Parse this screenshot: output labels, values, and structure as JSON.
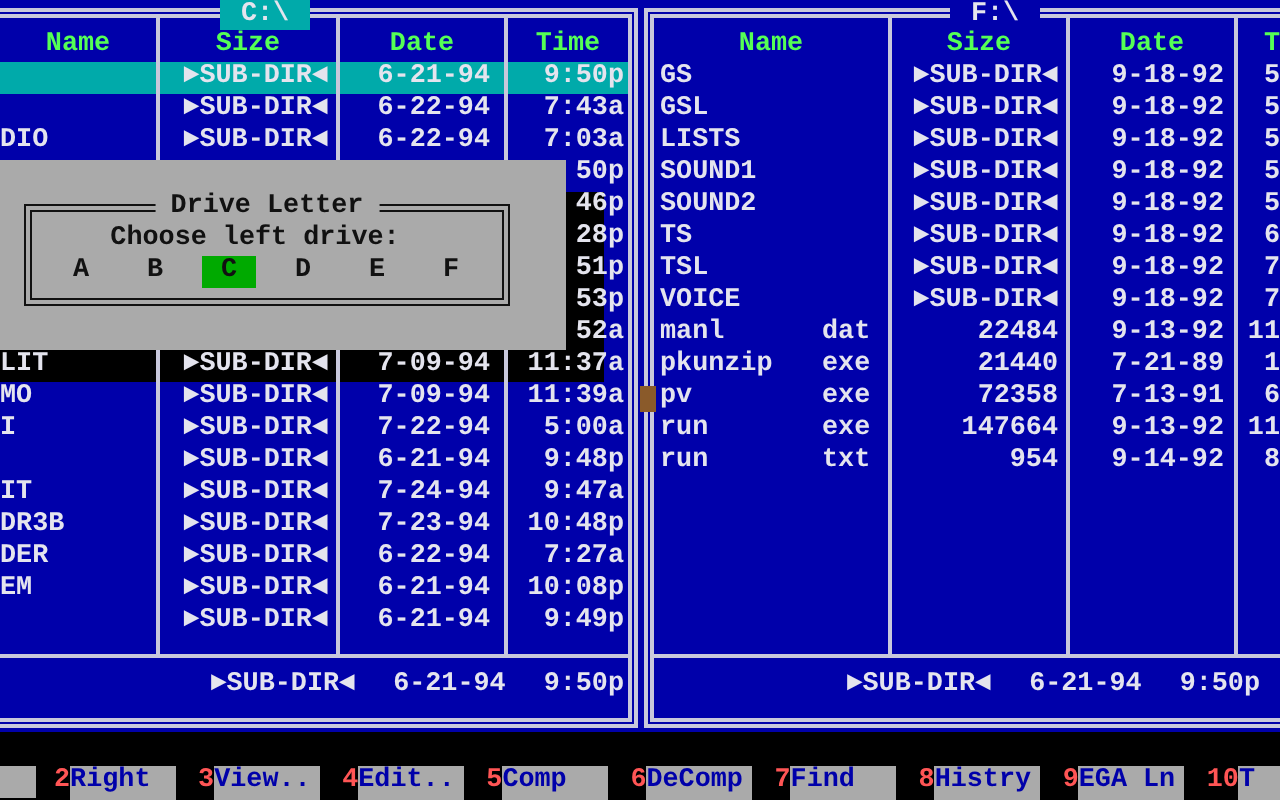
{
  "panels": [
    {
      "title": "C:\\",
      "active": true,
      "columns": [
        "Name",
        "Size",
        "Date",
        "Time"
      ],
      "rows": [
        {
          "size": "►SUB-DIR◄",
          "date": "6-21-94",
          "time": "9:50p",
          "selected": true
        },
        {
          "size": "►SUB-DIR◄",
          "date": "6-22-94",
          "time": "7:43a",
          "selected": false
        },
        {
          "name": "DIO",
          "size": "►SUB-DIR◄",
          "date": "6-22-94",
          "time": "7:03a",
          "selected": false
        },
        {
          "time": "50p",
          "selected": false
        },
        {
          "time": "46p",
          "selected": false
        },
        {
          "time": "28p",
          "selected": false
        },
        {
          "time": "51p",
          "selected": false
        },
        {
          "time": "53p",
          "selected": false
        },
        {
          "time": "52a",
          "selected": false
        },
        {
          "name": "LIT",
          "size": "►SUB-DIR◄",
          "date": "7-09-94",
          "time": "11:37a",
          "selected": false
        },
        {
          "name": "MO",
          "size": "►SUB-DIR◄",
          "date": "7-09-94",
          "time": "11:39a",
          "selected": false
        },
        {
          "name": "I",
          "size": "►SUB-DIR◄",
          "date": "7-22-94",
          "time": "5:00a",
          "selected": false
        },
        {
          "size": "►SUB-DIR◄",
          "date": "6-21-94",
          "time": "9:48p",
          "selected": false
        },
        {
          "name": "IT",
          "size": "►SUB-DIR◄",
          "date": "7-24-94",
          "time": "9:47a",
          "selected": false
        },
        {
          "name": "DR3B",
          "size": "►SUB-DIR◄",
          "date": "7-23-94",
          "time": "10:48p",
          "selected": false
        },
        {
          "name": "DER",
          "size": "►SUB-DIR◄",
          "date": "6-22-94",
          "time": "7:27a",
          "selected": false
        },
        {
          "name": "EM",
          "size": "►SUB-DIR◄",
          "date": "6-21-94",
          "time": "10:08p",
          "selected": false
        },
        {
          "size": "►SUB-DIR◄",
          "date": "6-21-94",
          "time": "9:49p",
          "selected": false
        }
      ],
      "status": {
        "size": "►SUB-DIR◄",
        "date": "6-21-94",
        "time": "9:50p"
      }
    },
    {
      "title": "F:\\",
      "active": false,
      "columns": [
        "Name",
        "Size",
        "Date",
        "T"
      ],
      "rows": [
        {
          "name": "GS",
          "size": "►SUB-DIR◄",
          "date": "9-18-92",
          "time": "5",
          "selected": false
        },
        {
          "name": "GSL",
          "size": "►SUB-DIR◄",
          "date": "9-18-92",
          "time": "5",
          "selected": false
        },
        {
          "name": "LISTS",
          "size": "►SUB-DIR◄",
          "date": "9-18-92",
          "time": "5",
          "selected": false
        },
        {
          "name": "SOUND1",
          "size": "►SUB-DIR◄",
          "date": "9-18-92",
          "time": "5",
          "selected": false
        },
        {
          "name": "SOUND2",
          "size": "►SUB-DIR◄",
          "date": "9-18-92",
          "time": "5",
          "selected": false
        },
        {
          "name": "TS",
          "size": "►SUB-DIR◄",
          "date": "9-18-92",
          "time": "6",
          "selected": false
        },
        {
          "name": "TSL",
          "size": "►SUB-DIR◄",
          "date": "9-18-92",
          "time": "7",
          "selected": false
        },
        {
          "name": "VOICE",
          "size": "►SUB-DIR◄",
          "date": "9-18-92",
          "time": "7",
          "selected": false
        },
        {
          "name": "manl",
          "ext": "dat",
          "size": "22484",
          "date": "9-13-92",
          "time": "11",
          "selected": false
        },
        {
          "name": "pkunzip",
          "ext": "exe",
          "size": "21440",
          "date": "7-21-89",
          "time": "1",
          "selected": false
        },
        {
          "name": "pv",
          "ext": "exe",
          "size": "72358",
          "date": "7-13-91",
          "time": "6",
          "selected": false
        },
        {
          "name": "run",
          "ext": "exe",
          "size": "147664",
          "date": "9-13-92",
          "time": "11",
          "selected": false
        },
        {
          "name": "run",
          "ext": "txt",
          "size": "954",
          "date": "9-14-92",
          "time": "8",
          "selected": false
        }
      ],
      "status": {
        "size": "►SUB-DIR◄",
        "date": "6-21-94",
        "time": "9:50p"
      }
    }
  ],
  "dialog": {
    "title": "Drive Letter",
    "prompt": "Choose **left** drive:",
    "drives": [
      {
        "letter": "A",
        "selected": false
      },
      {
        "letter": "B",
        "selected": false
      },
      {
        "letter": "C",
        "selected": true
      },
      {
        "letter": "D",
        "selected": false
      },
      {
        "letter": "E",
        "selected": false
      },
      {
        "letter": "F",
        "selected": false
      }
    ]
  },
  "function_keys": [
    {
      "number": "2",
      "label": "Right"
    },
    {
      "number": "3",
      "label": "View.."
    },
    {
      "number": "4",
      "label": "Edit.."
    },
    {
      "number": "5",
      "label": "Comp"
    },
    {
      "number": "6",
      "label": "DeComp"
    },
    {
      "number": "7",
      "label": "Find"
    },
    {
      "number": "8",
      "label": "Histry"
    },
    {
      "number": "9",
      "label": "EGA Ln"
    },
    {
      "number": "10",
      "label": "T"
    }
  ]
}
